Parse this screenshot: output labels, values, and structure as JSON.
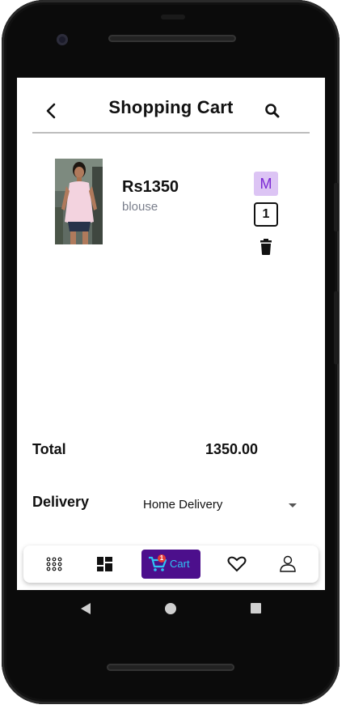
{
  "header": {
    "title": "Shopping Cart",
    "back_icon": "arrow-back-icon",
    "search_icon": "search-icon"
  },
  "cart_items": [
    {
      "price": "Rs1350",
      "name": "blouse",
      "size": "M",
      "quantity": "1",
      "image": "pink-blouse-photo",
      "delete_icon": "trash-icon"
    }
  ],
  "summary": {
    "total_label": "Total",
    "total_value": "1350.00",
    "delivery_label": "Delivery",
    "delivery_option": "Home Delivery"
  },
  "bottom_nav": {
    "items": [
      {
        "icon": "apps-grid-icon"
      },
      {
        "icon": "dashboard-icon"
      },
      {
        "icon": "cart-icon",
        "label": "Cart",
        "badge": "1",
        "active": true
      },
      {
        "icon": "heart-icon"
      },
      {
        "icon": "user-icon"
      }
    ]
  },
  "colors": {
    "size_badge_bg": "#dcc4f4",
    "size_badge_text": "#7b28d4",
    "active_nav_bg": "#4c0f8c",
    "active_nav_text": "#2ec4f5",
    "badge_red": "#e53935"
  }
}
